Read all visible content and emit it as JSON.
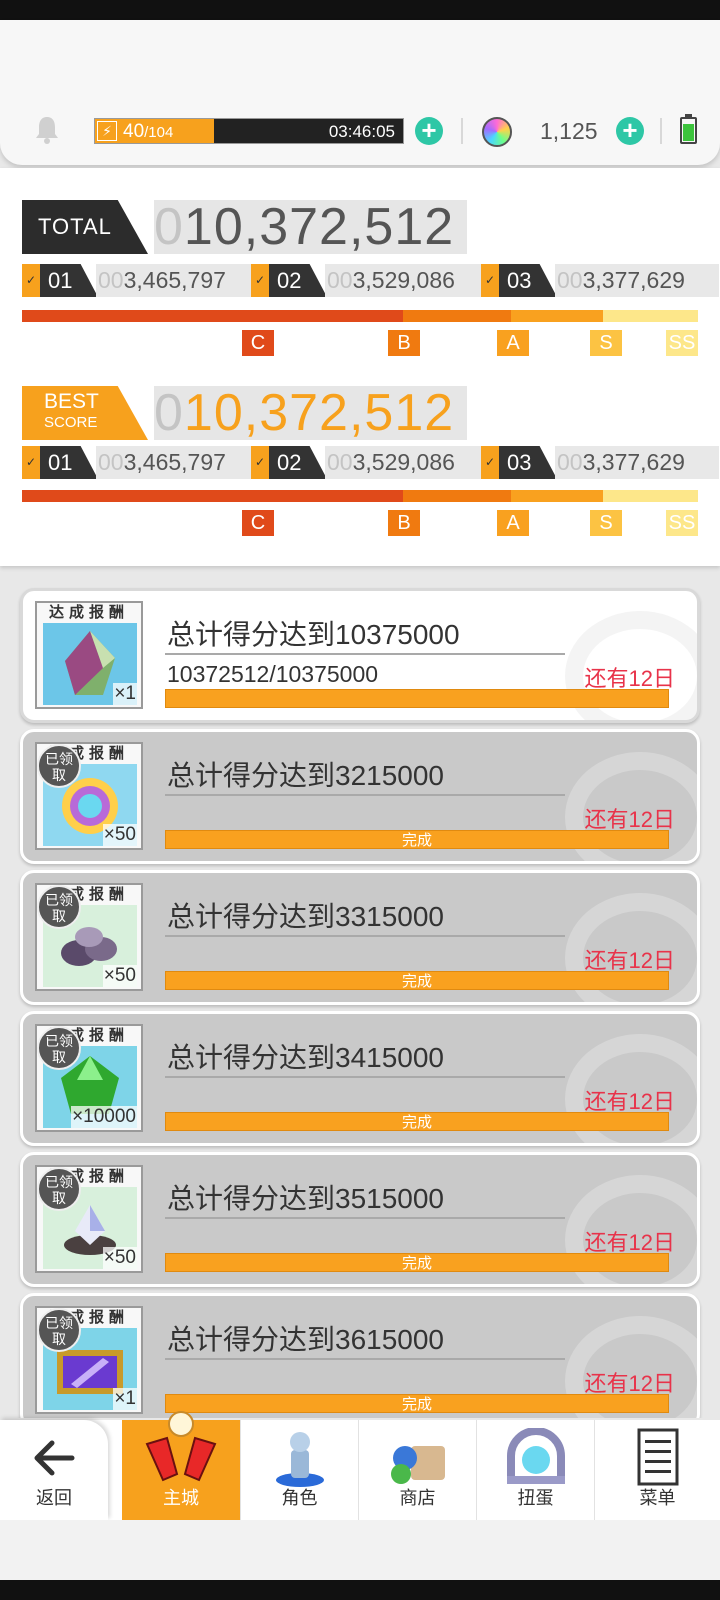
{
  "stamina": {
    "current": "40",
    "max": "/104",
    "timer": "03:46:05",
    "fraction": 0.385
  },
  "currency": {
    "gems": "1,125"
  },
  "total": {
    "label": "TOTAL",
    "score_lead": "0",
    "score_main": "10,372,512",
    "parts": [
      {
        "num": "01",
        "lead": "00",
        "val": "3,465,797"
      },
      {
        "num": "02",
        "lead": "00",
        "val": "3,529,086"
      },
      {
        "num": "03",
        "lead": "00",
        "val": "3,377,629"
      }
    ]
  },
  "best": {
    "label_line1": "BEST",
    "label_line2": "SCORE",
    "score_lead": "0",
    "score_main": "10,372,512",
    "parts": [
      {
        "num": "01",
        "lead": "00",
        "val": "3,465,797"
      },
      {
        "num": "02",
        "lead": "00",
        "val": "3,529,086"
      },
      {
        "num": "03",
        "lead": "00",
        "val": "3,377,629"
      }
    ]
  },
  "ranks": [
    "C",
    "B",
    "A",
    "S",
    "SS"
  ],
  "rank_colors": {
    "C": "#e04a1a",
    "B": "#f07a10",
    "A": "#f9a11f",
    "S": "#fcc343",
    "SS": "#fde78a"
  },
  "missions": [
    {
      "title": "总计得分达到10375000",
      "progress": "10372512/10375000",
      "remain": "还有12日",
      "bar": "",
      "reward_head": "达成报酬",
      "count": "×1",
      "claimed": "",
      "item_icon": "crystal-icon",
      "fill": 0.998
    },
    {
      "title": "总计得分达到3215000",
      "progress": "",
      "remain": "还有12日",
      "bar": "完成",
      "reward_head": "达成报酬",
      "count": "×50",
      "claimed": "已领取",
      "item_icon": "rainbow-orb-icon",
      "fill": 1
    },
    {
      "title": "总计得分达到3315000",
      "progress": "",
      "remain": "还有12日",
      "bar": "完成",
      "reward_head": "达成报酬",
      "count": "×50",
      "claimed": "已领取",
      "item_icon": "ore-icon",
      "fill": 1
    },
    {
      "title": "总计得分达到3415000",
      "progress": "",
      "remain": "还有12日",
      "bar": "完成",
      "reward_head": "达成报酬",
      "count": "×10000",
      "claimed": "已领取",
      "item_icon": "green-gem-icon",
      "fill": 1
    },
    {
      "title": "总计得分达到3515000",
      "progress": "",
      "remain": "还有12日",
      "bar": "完成",
      "reward_head": "达成报酬",
      "count": "×50",
      "claimed": "已领取",
      "item_icon": "crystal-shard-icon",
      "fill": 1
    },
    {
      "title": "总计得分达到3615000",
      "progress": "",
      "remain": "还有12日",
      "bar": "完成",
      "reward_head": "达成报酬",
      "count": "×1",
      "claimed": "已领取",
      "item_icon": "purple-ticket-icon",
      "fill": 1
    }
  ],
  "nav": {
    "back": "返回",
    "items": [
      "主城",
      "角色",
      "商店",
      "扭蛋",
      "菜单"
    ]
  },
  "colors": {
    "accent": "#f7a11d",
    "dark": "#2c2c2c",
    "teal": "#2ec7a6",
    "remain": "#e8334a"
  }
}
